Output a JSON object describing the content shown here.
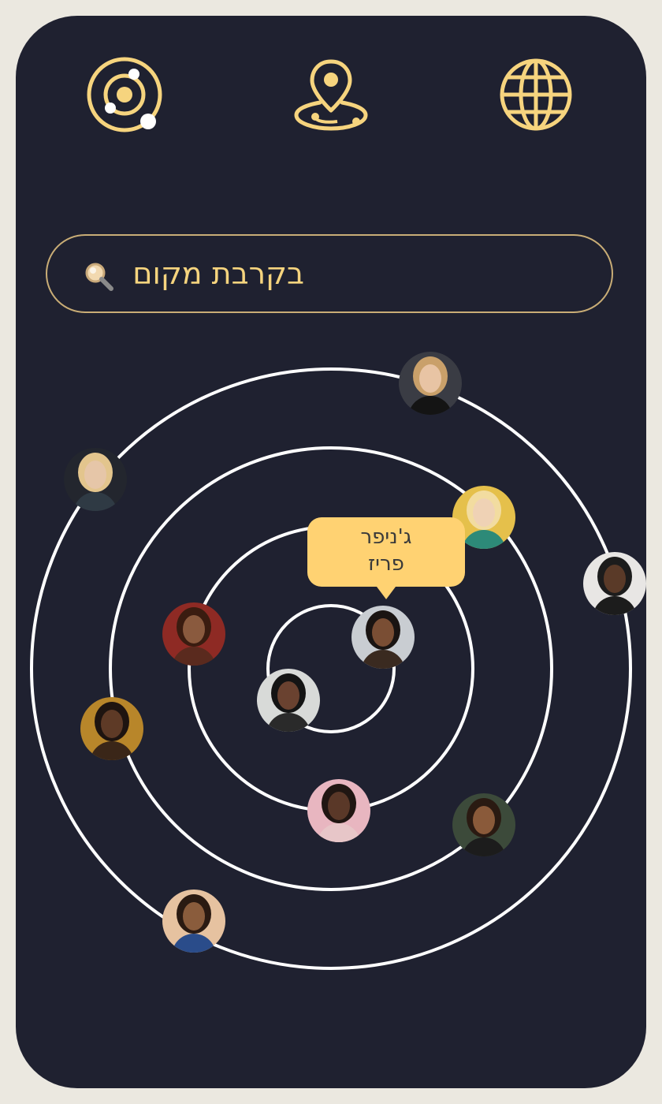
{
  "nav": {
    "items": [
      {
        "icon": "orbit-icon"
      },
      {
        "icon": "location-pin-icon"
      },
      {
        "icon": "globe-icon"
      }
    ]
  },
  "search": {
    "placeholder": "בקרבת מקום",
    "icon": "search-icon"
  },
  "tooltip": {
    "name": "ג'ניפר",
    "city": "פריז"
  },
  "colors": {
    "background": "#1f2130",
    "frame": "#ebe8e0",
    "accent": "#f6d47e",
    "search_border": "#c9ad76",
    "tooltip_bg": "#ffd272",
    "orbit": "#ffffff"
  },
  "avatars": [
    {
      "name": "avatar-blonde-woman-dark-top",
      "bg": "#3a3c44",
      "skin": "#e8c4a4",
      "hair": "#c9a06a",
      "clothes": "#141414"
    },
    {
      "name": "avatar-blonde-woman-curly",
      "bg": "#23262e",
      "skin": "#e6c6a8",
      "hair": "#e3c58d",
      "clothes": "#2f3a44"
    },
    {
      "name": "avatar-woman-sunglasses-yellow",
      "bg": "#e5c04b",
      "skin": "#efd2b5",
      "hair": "#f2dca0",
      "clothes": "#2d8a78"
    },
    {
      "name": "avatar-woman-hijab",
      "bg": "#e8e6e4",
      "skin": "#5a3a28",
      "hair": "#1c1c1c",
      "clothes": "#1c1c1c"
    },
    {
      "name": "avatar-woman-red-background",
      "bg": "#8e2a24",
      "skin": "#8a5a3e",
      "hair": "#3a1c10",
      "clothes": "#5a2a1e"
    },
    {
      "name": "avatar-jennifer-sunglasses",
      "bg": "#c9cdd2",
      "skin": "#7a4e34",
      "hair": "#1a1412",
      "clothes": "#3a2a20"
    },
    {
      "name": "avatar-woman-dark-hair",
      "bg": "#d8dad8",
      "skin": "#6a4230",
      "hair": "#141414",
      "clothes": "#2a2a2a"
    },
    {
      "name": "avatar-woman-gold-freckles",
      "bg": "#b8862a",
      "skin": "#5e3a26",
      "hair": "#1e1410",
      "clothes": "#3a2618"
    },
    {
      "name": "avatar-girl-pink-background",
      "bg": "#e8b6c0",
      "skin": "#5a3828",
      "hair": "#201612",
      "clothes": "#e7c6c8"
    },
    {
      "name": "avatar-woman-orange-flowers",
      "bg": "#3c4a3a",
      "skin": "#8a5a3a",
      "hair": "#2a1a12",
      "clothes": "#1c1c1c"
    },
    {
      "name": "avatar-woman-blue-jeans",
      "bg": "#e6c2a0",
      "skin": "#8a5c3c",
      "hair": "#2a1a12",
      "clothes": "#2a4c8a"
    }
  ]
}
